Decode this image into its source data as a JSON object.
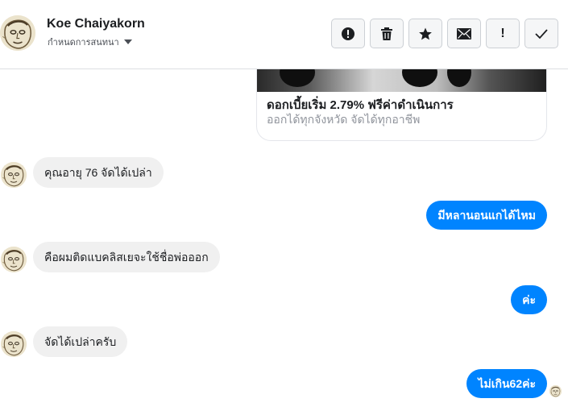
{
  "header": {
    "name": "Koe Chaiyakorn",
    "subtitle": "กำหนดการสนทนา",
    "actions": [
      {
        "icon": "report-icon",
        "label": "!"
      },
      {
        "icon": "trash-icon"
      },
      {
        "icon": "star-icon"
      },
      {
        "icon": "envelope-icon"
      },
      {
        "icon": "exclamation-icon",
        "label": "!"
      },
      {
        "icon": "checkmark-icon"
      }
    ]
  },
  "link_preview": {
    "title": "ดอกเบี้ยเริ่ม 2.79% ฟรีค่าดำเนินการ",
    "description": "ออกได้ทุกจังหวัด จัดได้ทุกอาชีพ"
  },
  "messages": [
    {
      "direction": "incoming",
      "text": "คุณอายุ 76 จัดได้เปล่า"
    },
    {
      "direction": "outgoing",
      "text": "มีหลานอนแกได้ไหม"
    },
    {
      "direction": "incoming",
      "text": "คือผมติดแบคลิสเยจะใช้ชื่อพ่อออก"
    },
    {
      "direction": "outgoing",
      "text": "ค่ะ"
    },
    {
      "direction": "incoming",
      "text": "จัดได้เปล่าครับ"
    },
    {
      "direction": "outgoing",
      "text": "ไม่เกิน62ค่ะ"
    }
  ],
  "colors": {
    "outgoing_bubble": "#0084ff",
    "incoming_bubble": "#f0f0f0",
    "border": "#dddfe2"
  }
}
